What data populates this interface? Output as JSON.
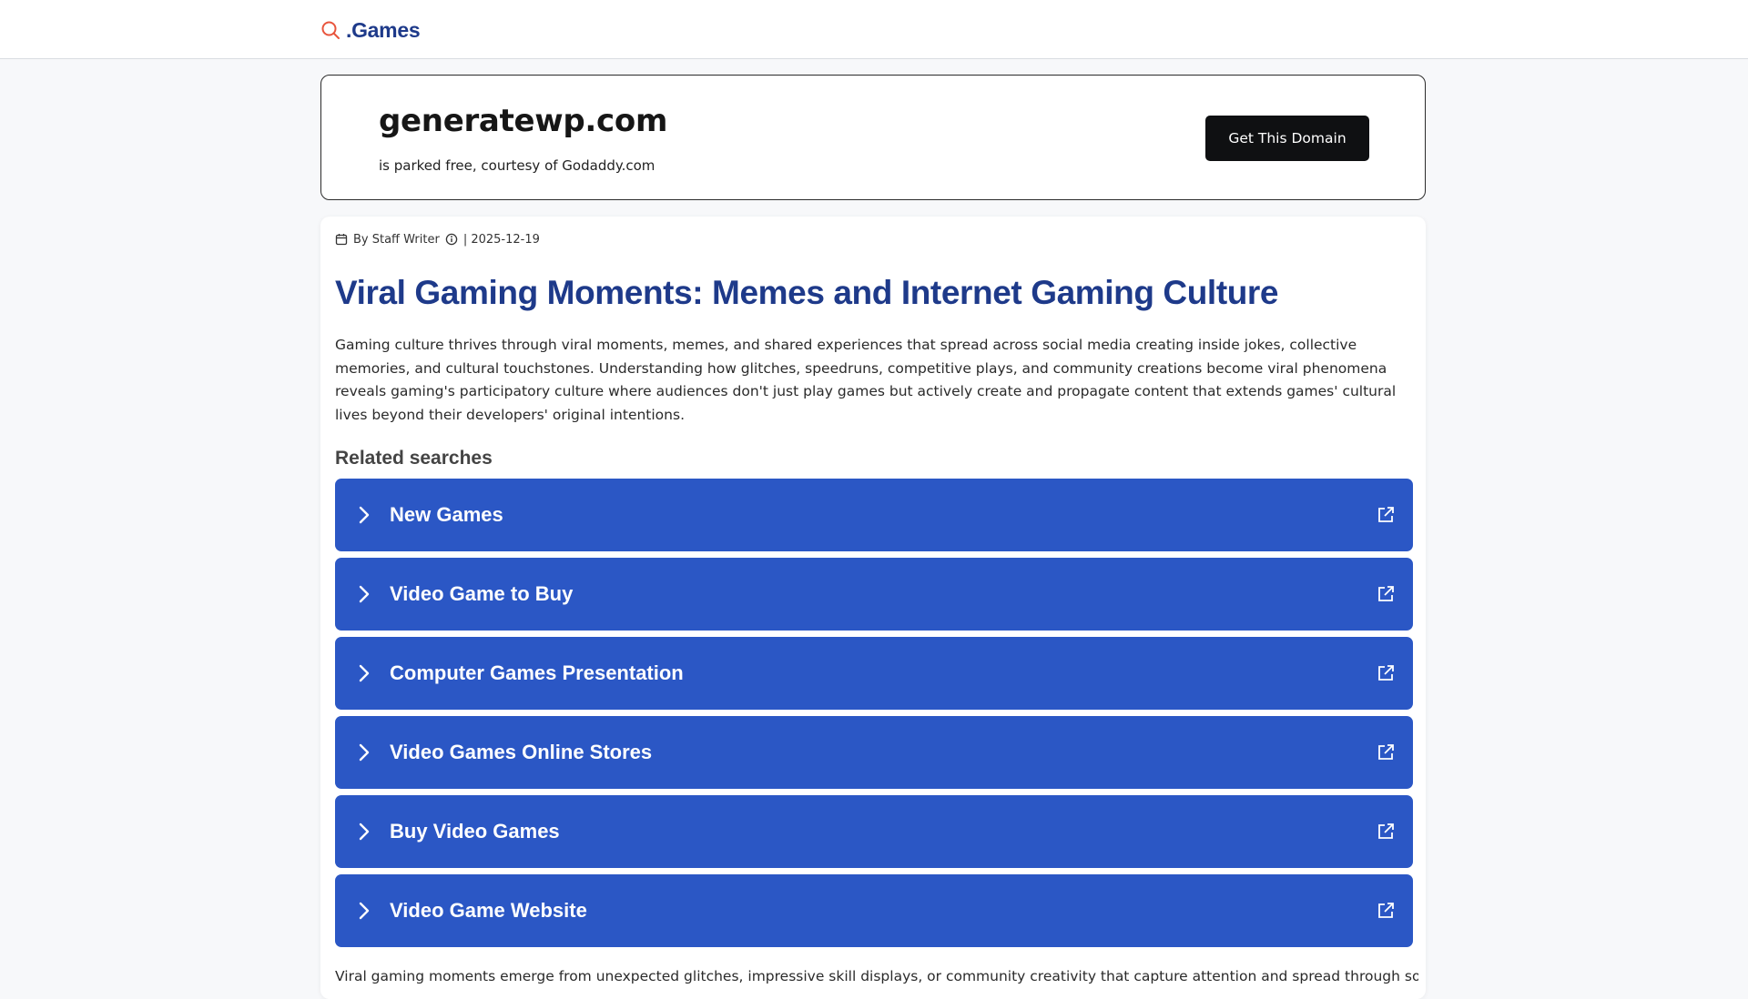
{
  "header": {
    "brand_icon": "search-icon",
    "brand_text": ".Games"
  },
  "domain_banner": {
    "domain": "generatewp.com",
    "subtitle": "is parked free, courtesy of Godaddy.com",
    "cta_label": "Get This Domain"
  },
  "article": {
    "meta": {
      "calendar_icon": "calendar-icon",
      "author": "By Staff Writer",
      "info_icon": "info-icon",
      "date": "| 2025-12-19"
    },
    "title": "Viral Gaming Moments: Memes and Internet Gaming Culture",
    "intro": "Gaming culture thrives through viral moments, memes, and shared experiences that spread across social media creating inside jokes, collective memories, and cultural touchstones. Understanding how glitches, speedruns, competitive plays, and community creations become viral phenomena reveals gaming's participatory culture where audiences don't just play games but actively create and propagate content that extends games' cultural lives beyond their developers' original intentions.",
    "related_heading": "Related searches",
    "related": [
      {
        "label": "New Games"
      },
      {
        "label": "Video Game to Buy"
      },
      {
        "label": "Computer Games Presentation"
      },
      {
        "label": "Video Games Online Stores"
      },
      {
        "label": "Buy Video Games"
      },
      {
        "label": "Video Game Website"
      }
    ],
    "body_start": "Viral gaming moments emerge from unexpected glitches, impressive skill displays, or community creativity that capture attention and spread through social"
  },
  "colors": {
    "accent": "#1e3a8a",
    "button_blue": "#2b57c5",
    "cta_black": "#0f1012",
    "brand_icon": "#e8553d"
  }
}
